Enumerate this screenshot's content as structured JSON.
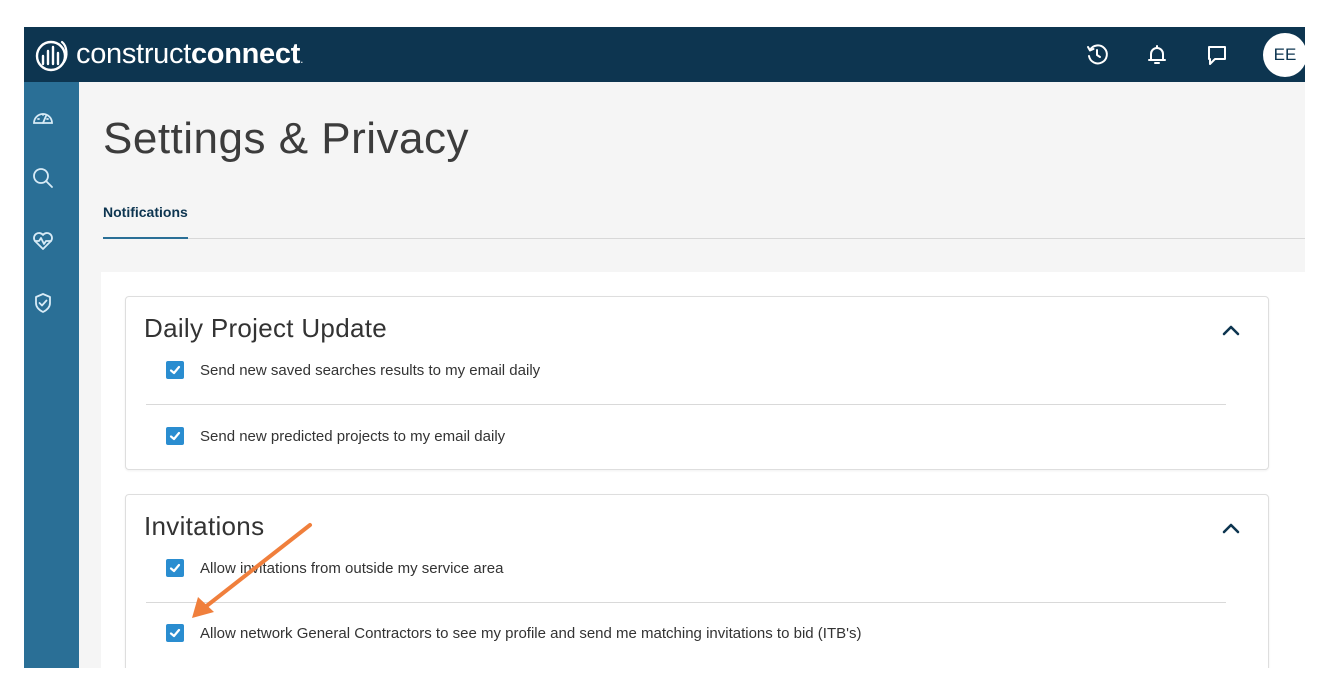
{
  "brand": {
    "light": "construct",
    "bold": "connect",
    "dot": "."
  },
  "header": {
    "icons": [
      "history-icon",
      "bell-icon",
      "chat-icon"
    ],
    "avatar_initials": "EE"
  },
  "sidebar": {
    "icons": [
      "dashboard-icon",
      "search-icon",
      "heart-pulse-icon",
      "shield-check-icon"
    ]
  },
  "page": {
    "title": "Settings & Privacy"
  },
  "tabs": [
    {
      "label": "Notifications",
      "active": true
    }
  ],
  "sections": [
    {
      "title": "Daily Project Update",
      "expanded": true,
      "options": [
        {
          "label": "Send new saved searches results to my email daily",
          "checked": true
        },
        {
          "label": "Send new predicted projects to my email daily",
          "checked": true
        }
      ]
    },
    {
      "title": "Invitations",
      "expanded": true,
      "options": [
        {
          "label": "Allow invitations from outside my service area",
          "checked": true
        },
        {
          "label": "Allow network General Contractors to see my profile and send me matching invitations to bid (ITB's)",
          "checked": true
        }
      ]
    }
  ],
  "colors": {
    "header_bg": "#0d3550",
    "sidebar_bg": "#2a6f96",
    "checkbox": "#2a8dd0",
    "annotation_arrow": "#f07f3c"
  }
}
